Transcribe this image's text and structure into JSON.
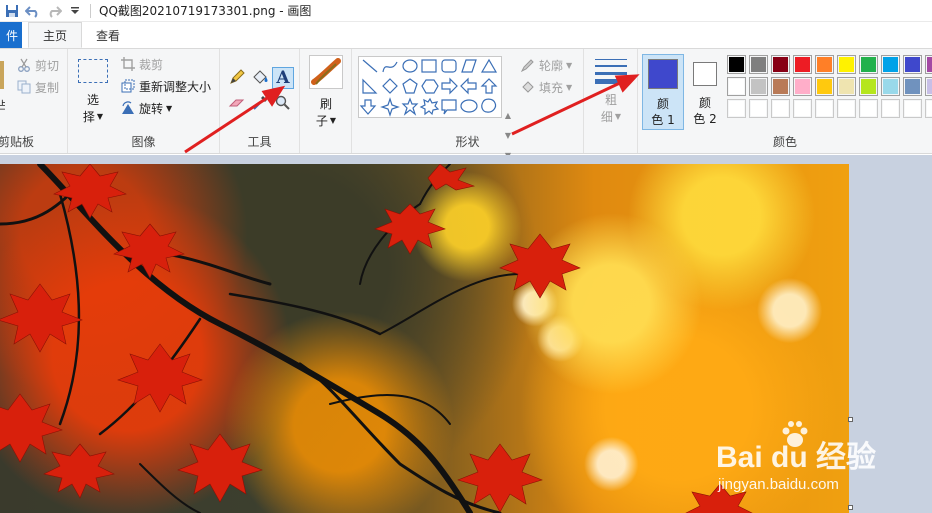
{
  "window": {
    "title": "QQ截图20210719173301.png - 画图"
  },
  "tabs": {
    "file_label": "件",
    "home_label": "主页",
    "view_label": "查看"
  },
  "clipboard": {
    "group_label": "剪贴板",
    "paste_partial": "占",
    "cut_label": "剪切",
    "copy_label": "复制"
  },
  "image": {
    "group_label": "图像",
    "select_line1": "选",
    "select_line2": "择",
    "crop_label": "裁剪",
    "resize_label": "重新调整大小",
    "rotate_label": "旋转"
  },
  "tools": {
    "group_label": "工具",
    "brushes_line1": "刷",
    "brushes_line2": "子"
  },
  "shapes": {
    "group_label": "形状",
    "outline_label": "轮廓",
    "fill_label": "填充"
  },
  "size": {
    "line1": "粗",
    "line2": "细"
  },
  "colors": {
    "group_label": "颜色",
    "color1_line1": "颜",
    "color1_line2": "色 1",
    "color2_line1": "颜",
    "color2_line2": "色 2",
    "color1_value": "#3f48cc",
    "color2_value": "#ffffff",
    "palette_row1": [
      "#000000",
      "#7f7f7f",
      "#880015",
      "#ed1c24",
      "#ff7f27",
      "#fff200",
      "#22b14c",
      "#00a2e8",
      "#3f48cc",
      "#a349a4"
    ],
    "palette_row2": [
      "#ffffff",
      "#c3c3c3",
      "#b97a57",
      "#ffaec9",
      "#ffc90e",
      "#efe4b0",
      "#b5e61d",
      "#99d9ea",
      "#7092be",
      "#c8bfe7"
    ]
  },
  "watermark": {
    "brand": "Bai du 经验",
    "url": "jingyan.baidu.com"
  }
}
